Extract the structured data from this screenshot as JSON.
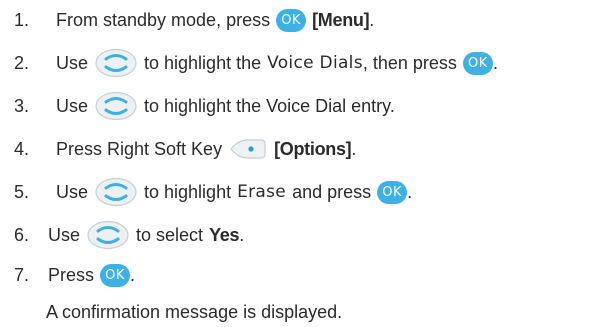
{
  "steps": [
    {
      "num": "1.",
      "parts": [
        {
          "t": "text",
          "v": "From standby mode, press"
        },
        {
          "t": "ok",
          "v": "OK"
        },
        {
          "t": "bold",
          "v": "[Menu]"
        },
        {
          "t": "text",
          "v": "."
        }
      ]
    },
    {
      "num": "2.",
      "parts": [
        {
          "t": "text",
          "v": "Use"
        },
        {
          "t": "nav"
        },
        {
          "t": "text",
          "v": "to highlight the"
        },
        {
          "t": "ui",
          "v": "Voice Dials"
        },
        {
          "t": "text",
          "v": ", then press"
        },
        {
          "t": "ok",
          "v": "OK"
        },
        {
          "t": "text",
          "v": "."
        }
      ]
    },
    {
      "num": "3.",
      "parts": [
        {
          "t": "text",
          "v": "Use"
        },
        {
          "t": "nav"
        },
        {
          "t": "text",
          "v": "to highlight the Voice Dial entry."
        }
      ]
    },
    {
      "num": "4.",
      "parts": [
        {
          "t": "text",
          "v": "Press Right Soft Key"
        },
        {
          "t": "softkey"
        },
        {
          "t": "bold",
          "v": "[Options]"
        },
        {
          "t": "text",
          "v": "."
        }
      ]
    },
    {
      "num": "5.",
      "parts": [
        {
          "t": "text",
          "v": "Use"
        },
        {
          "t": "nav"
        },
        {
          "t": "text",
          "v": "to highlight"
        },
        {
          "t": "ui",
          "v": "Erase"
        },
        {
          "t": "text",
          "v": "and press"
        },
        {
          "t": "ok",
          "v": "OK"
        },
        {
          "t": "text",
          "v": "."
        }
      ]
    },
    {
      "num": "6.",
      "parts": [
        {
          "t": "text",
          "v": "Use"
        },
        {
          "t": "nav"
        },
        {
          "t": "text",
          "v": "to select"
        },
        {
          "t": "bold",
          "v": "Yes"
        },
        {
          "t": "text",
          "v": "."
        }
      ]
    },
    {
      "num": "7.",
      "parts": [
        {
          "t": "text",
          "v": "Press"
        },
        {
          "t": "ok",
          "v": "OK"
        },
        {
          "t": "text",
          "v": "."
        }
      ]
    }
  ],
  "note": "A confirmation message is displayed.",
  "colors": {
    "ok_button": "#3db0e4",
    "nav_key_ring": "#3db0e4",
    "text": "#2b2b2b"
  },
  "icons": {
    "ok": "ok-key-icon",
    "nav": "navigation-key-icon",
    "softkey": "right-soft-key-icon"
  }
}
